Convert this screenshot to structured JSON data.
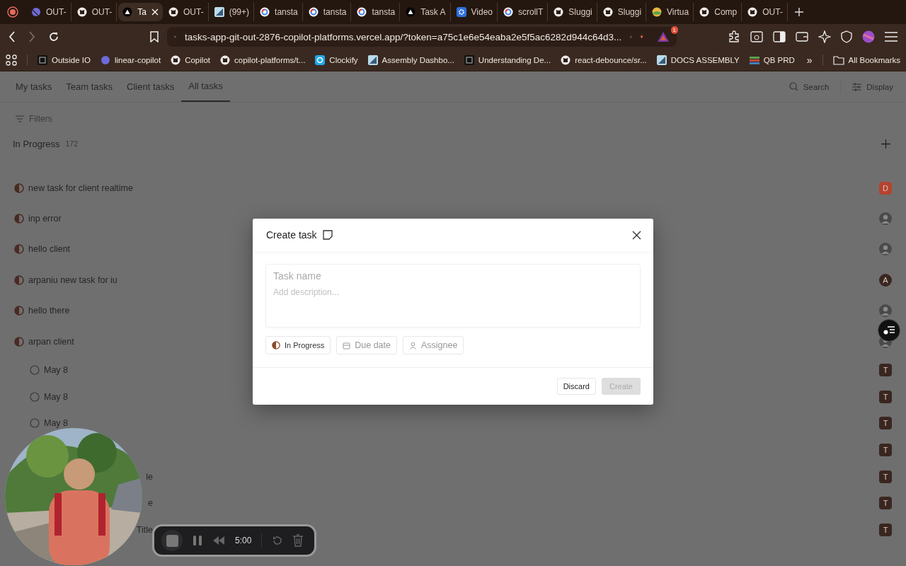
{
  "browser": {
    "tabs": [
      {
        "kind": "planet",
        "title": "OUT-",
        "selected": false
      },
      {
        "kind": "cat",
        "title": "OUT-",
        "selected": false
      },
      {
        "kind": "triangle",
        "title": "Ta",
        "selected": true
      },
      {
        "kind": "cat",
        "title": "OUT-",
        "selected": false
      },
      {
        "kind": "stairs",
        "title": "(99+)",
        "selected": false
      },
      {
        "kind": "ring",
        "title": "tansta",
        "selected": false
      },
      {
        "kind": "ring",
        "title": "tansta",
        "selected": false
      },
      {
        "kind": "ring",
        "title": "tansta",
        "selected": false
      },
      {
        "kind": "triangle",
        "title": "Task A",
        "selected": false
      },
      {
        "kind": "gear",
        "title": "Video",
        "selected": false
      },
      {
        "kind": "ring",
        "title": "scrollT",
        "selected": false
      },
      {
        "kind": "cat",
        "title": "Sluggi",
        "selected": false
      },
      {
        "kind": "cat",
        "title": "Sluggi",
        "selected": false
      },
      {
        "kind": "globe",
        "title": "Virtua",
        "selected": false
      },
      {
        "kind": "cat",
        "title": "Comp",
        "selected": false
      },
      {
        "kind": "cat",
        "title": "OUT-",
        "selected": false
      }
    ],
    "url": "tasks-app-git-out-2876-copilot-platforms.vercel.app/?token=a75c1e6e54eaba2e5f5ac6282d944c64d3...",
    "extension_badge": "1",
    "bookmarks": [
      {
        "kind": "square",
        "label": "Outside IO"
      },
      {
        "kind": "planet",
        "label": "linear-copilot"
      },
      {
        "kind": "cat",
        "label": "Copilot"
      },
      {
        "kind": "cat",
        "label": "copilot-platforms/t..."
      },
      {
        "kind": "clock",
        "label": "Clockify"
      },
      {
        "kind": "stairs",
        "label": "Assembly Dashbo..."
      },
      {
        "kind": "square",
        "label": "Understanding De..."
      },
      {
        "kind": "cat",
        "label": "react-debounce/sr..."
      },
      {
        "kind": "stairs",
        "label": "DOCS ASSEMBLY"
      },
      {
        "kind": "books",
        "label": "QB PRD"
      }
    ],
    "more": "»",
    "all_bookmarks": "All Bookmarks"
  },
  "app": {
    "tabs": [
      {
        "label": "My tasks",
        "selected": false
      },
      {
        "label": "Team tasks",
        "selected": false
      },
      {
        "label": "Client tasks",
        "selected": false
      },
      {
        "label": "All tasks",
        "selected": true
      }
    ],
    "search": "Search",
    "display": "Display",
    "filters": "Filters",
    "group": {
      "title": "In Progress",
      "count": "172",
      "rows": [
        {
          "kind": "in_progress",
          "title": "new task for client realtime",
          "avatar": {
            "kind": "letter_square",
            "letter": "D",
            "color": "#b4432f"
          }
        },
        {
          "kind": "in_progress",
          "title": "inp error"
        },
        {
          "kind": "in_progress",
          "title": "hello client"
        },
        {
          "kind": "in_progress",
          "title": "arpaniu new task for iu",
          "avatar": {
            "kind": "letter_circle",
            "letter": "A",
            "color": "#3a2620"
          }
        },
        {
          "kind": "in_progress",
          "title": "hello there"
        },
        {
          "kind": "in_progress",
          "title": "arpan client",
          "children": [
            {
              "kind": "todo",
              "title": "May 8",
              "avatar": {
                "kind": "letter_square",
                "letter": "T",
                "color": "#3a2620"
              }
            },
            {
              "kind": "todo",
              "title": "May 8",
              "avatar": {
                "kind": "letter_square",
                "letter": "T",
                "color": "#3a2620"
              }
            },
            {
              "kind": "todo",
              "title": "May 8",
              "avatar": {
                "kind": "letter_square",
                "letter": "T",
                "color": "#3a2620"
              }
            },
            {
              "kind": "covered",
              "avatar": {
                "kind": "letter_square",
                "letter": "T",
                "color": "#3a2620"
              }
            },
            {
              "kind": "covered",
              "title": "le",
              "avatar": {
                "kind": "letter_square",
                "letter": "T",
                "color": "#3a2620"
              }
            },
            {
              "kind": "covered",
              "title": "e",
              "avatar": {
                "kind": "letter_square",
                "letter": "T",
                "color": "#3a2620"
              }
            },
            {
              "kind": "covered",
              "title": "Title",
              "avatar": {
                "kind": "letter_square",
                "letter": "T",
                "color": "#3a2620"
              }
            }
          ]
        }
      ]
    }
  },
  "modal": {
    "title": "Create task",
    "name_placeholder": "Task name",
    "description_placeholder": "Add description...",
    "chips": [
      {
        "kind": "status",
        "label": "In Progress"
      },
      {
        "kind": "date",
        "label": "Due date"
      },
      {
        "kind": "assignee",
        "label": "Assignee"
      }
    ],
    "discard": "Discard",
    "create": {
      "label": "Create",
      "disabled": true
    }
  },
  "recorder": {
    "time": "5:00"
  }
}
